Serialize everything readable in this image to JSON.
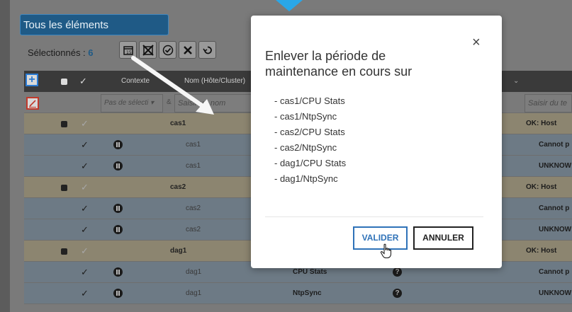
{
  "header": {
    "title": "Tous les éléments"
  },
  "selection": {
    "label": "Sélectionnés :",
    "count": "6"
  },
  "toolbar": [
    "calendar-icon",
    "calendar-remove-icon",
    "check-circle-icon",
    "tools-icon",
    "undo-icon"
  ],
  "grid": {
    "columns": {
      "context": "Contexte",
      "name": "Nom (Hôte/Cluster)"
    },
    "filters": {
      "context_select": "Pas de sélecti",
      "amp": "&",
      "name_placeholder": "Saisir un nom",
      "text_placeholder": "Saisir du te"
    },
    "rows": [
      {
        "type": "group",
        "name": "cas1",
        "status": "OK: Host alive"
      },
      {
        "type": "item",
        "name": "cas1",
        "service": "",
        "status": "Cannot p"
      },
      {
        "type": "item",
        "name": "cas1",
        "service": "",
        "status": "UNKNOW"
      },
      {
        "type": "group",
        "name": "cas2",
        "status": "OK: Host alive"
      },
      {
        "type": "item",
        "name": "cas2",
        "service": "",
        "status": "Cannot p"
      },
      {
        "type": "item",
        "name": "cas2",
        "service": "",
        "status": "UNKNOW"
      },
      {
        "type": "group",
        "name": "dag1",
        "status": "OK: Host alive"
      },
      {
        "type": "item",
        "name": "dag1",
        "service": "CPU Stats",
        "status": "Cannot p"
      },
      {
        "type": "item",
        "name": "dag1",
        "service": "NtpSync",
        "status": "UNKNOW"
      }
    ]
  },
  "modal": {
    "title": "Enlever la période de maintenance en cours sur",
    "close": "×",
    "items": [
      "- cas1/CPU Stats",
      "- cas1/NtpSync",
      "- cas2/CPU Stats",
      "- cas2/NtpSync",
      "- dag1/CPU Stats",
      "- dag1/NtpSync"
    ],
    "confirm_label": "VALIDER",
    "cancel_label": "ANNULER"
  },
  "colors": {
    "accent": "#2f72b8",
    "pointer": "#2aa7e8",
    "annotation_arrow": "#ffffff"
  }
}
